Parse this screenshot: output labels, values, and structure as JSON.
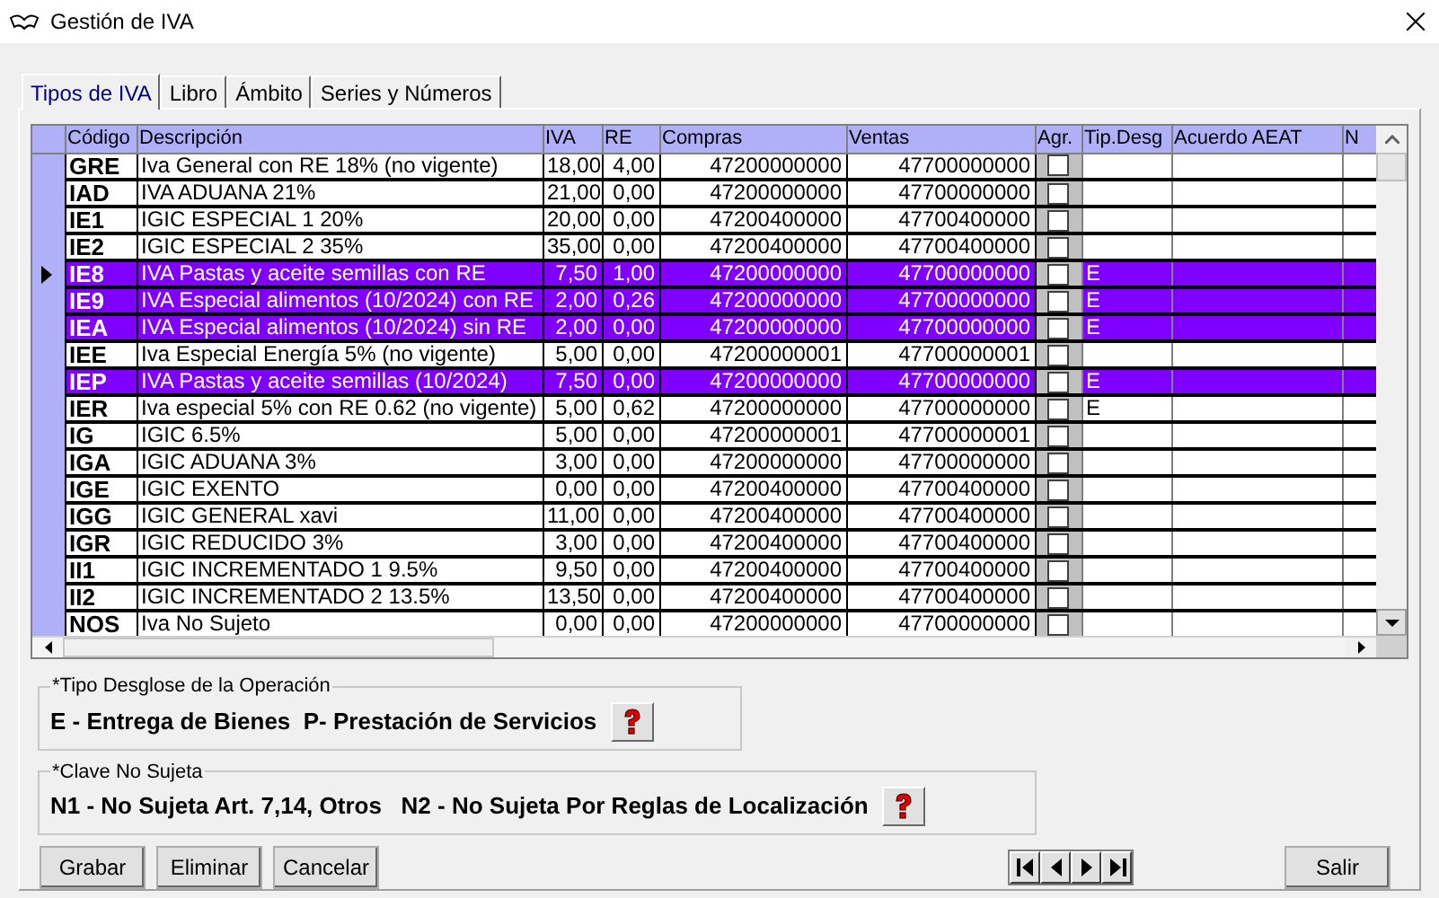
{
  "window": {
    "title": "Gestión de IVA"
  },
  "tabs": [
    {
      "label": "Tipos de IVA",
      "selected": true
    },
    {
      "label": "Libro",
      "selected": false
    },
    {
      "label": "Ámbito",
      "selected": false
    },
    {
      "label": "Series y Números",
      "selected": false
    }
  ],
  "table": {
    "columns": [
      "Código",
      "Descripción",
      "IVA",
      "RE",
      "Compras",
      "Ventas",
      "Agr.",
      "Tip.Desg",
      "Acuerdo AEAT",
      "N"
    ],
    "rows": [
      {
        "code": "GRE",
        "description": "Iva General con RE 18% (no vigente)",
        "iva": "18,00",
        "re": "4,00",
        "compras": "47200000000",
        "ventas": "47700000000",
        "agr": false,
        "selected": false,
        "current": false
      },
      {
        "code": "IAD",
        "description": "IVA ADUANA 21%",
        "iva": "21,00",
        "re": "0,00",
        "compras": "47200000000",
        "ventas": "47700000000",
        "agr": false,
        "selected": false,
        "current": false
      },
      {
        "code": "IE1",
        "description": "IGIC ESPECIAL 1 20%",
        "iva": "20,00",
        "re": "0,00",
        "compras": "47200400000",
        "ventas": "47700400000",
        "agr": false,
        "selected": false,
        "current": false
      },
      {
        "code": "IE2",
        "description": "IGIC ESPECIAL 2 35%",
        "iva": "35,00",
        "re": "0,00",
        "compras": "47200400000",
        "ventas": "47700400000",
        "agr": false,
        "selected": false,
        "current": false
      },
      {
        "code": "IE8",
        "description": "IVA Pastas y aceite semillas con RE",
        "iva": "7,50",
        "re": "1,00",
        "compras": "47200000000",
        "ventas": "47700000000",
        "agr": false,
        "tip_desg": "E",
        "selected": true,
        "current": true
      },
      {
        "code": "IE9",
        "description": "IVA Especial alimentos (10/2024) con RE",
        "iva": "2,00",
        "re": "0,26",
        "compras": "47200000000",
        "ventas": "47700000000",
        "agr": false,
        "tip_desg": "E",
        "selected": true,
        "current": false
      },
      {
        "code": "IEA",
        "description": "IVA Especial alimentos (10/2024) sin RE",
        "iva": "2,00",
        "re": "0,00",
        "compras": "47200000000",
        "ventas": "47700000000",
        "agr": false,
        "tip_desg": "E",
        "selected": true,
        "current": false
      },
      {
        "code": "IEE",
        "description": "Iva Especial Energía 5% (no vigente)",
        "iva": "5,00",
        "re": "0,00",
        "compras": "47200000001",
        "ventas": "47700000001",
        "agr": false,
        "selected": false,
        "current": false
      },
      {
        "code": "IEP",
        "description": "IVA Pastas y aceite semillas (10/2024)",
        "iva": "7,50",
        "re": "0,00",
        "compras": "47200000000",
        "ventas": "47700000000",
        "agr": false,
        "tip_desg": "E",
        "selected": true,
        "current": false
      },
      {
        "code": "IER",
        "description": "Iva especial 5% con RE 0.62 (no vigente)",
        "iva": "5,00",
        "re": "0,62",
        "compras": "47200000000",
        "ventas": "47700000000",
        "agr": false,
        "tip_desg": "E",
        "selected": false,
        "current": false
      },
      {
        "code": "IG",
        "description": "IGIC 6.5%",
        "iva": "5,00",
        "re": "0,00",
        "compras": "47200000001",
        "ventas": "47700000001",
        "agr": false,
        "selected": false,
        "current": false
      },
      {
        "code": "IGA",
        "description": "IGIC ADUANA 3%",
        "iva": "3,00",
        "re": "0,00",
        "compras": "47200000000",
        "ventas": "47700000000",
        "agr": false,
        "selected": false,
        "current": false
      },
      {
        "code": "IGE",
        "description": "IGIC EXENTO",
        "iva": "0,00",
        "re": "0,00",
        "compras": "47200400000",
        "ventas": "47700400000",
        "agr": false,
        "selected": false,
        "current": false
      },
      {
        "code": "IGG",
        "description": "IGIC GENERAL xavi",
        "iva": "11,00",
        "re": "0,00",
        "compras": "47200400000",
        "ventas": "47700400000",
        "agr": false,
        "selected": false,
        "current": false
      },
      {
        "code": "IGR",
        "description": "IGIC REDUCIDO 3%",
        "iva": "3,00",
        "re": "0,00",
        "compras": "47200400000",
        "ventas": "47700400000",
        "agr": false,
        "selected": false,
        "current": false
      },
      {
        "code": "II1",
        "description": "IGIC INCREMENTADO 1 9.5%",
        "iva": "9,50",
        "re": "0,00",
        "compras": "47200400000",
        "ventas": "47700400000",
        "agr": false,
        "selected": false,
        "current": false
      },
      {
        "code": "II2",
        "description": "IGIC INCREMENTADO 2 13.5%",
        "iva": "13,50",
        "re": "0,00",
        "compras": "47200400000",
        "ventas": "47700400000",
        "agr": false,
        "selected": false,
        "current": false
      },
      {
        "code": "NOS",
        "description": "Iva No Sujeto",
        "iva": "0,00",
        "re": "0,00",
        "compras": "47200000000",
        "ventas": "47700000000",
        "agr": false,
        "selected": false,
        "current": false
      }
    ]
  },
  "desglose": {
    "legend": "*Tipo Desglose de la Operación",
    "text": "E - Entrega de Bienes  P- Prestación de Servicios"
  },
  "clave": {
    "legend": "*Clave No Sujeta",
    "text": "N1 - No Sujeta Art. 7,14, Otros   N2 - No Sujeta Por Reglas de Localización"
  },
  "buttons": [
    "Grabar",
    "Eliminar",
    "Cancelar"
  ],
  "exit_button": "Salir"
}
